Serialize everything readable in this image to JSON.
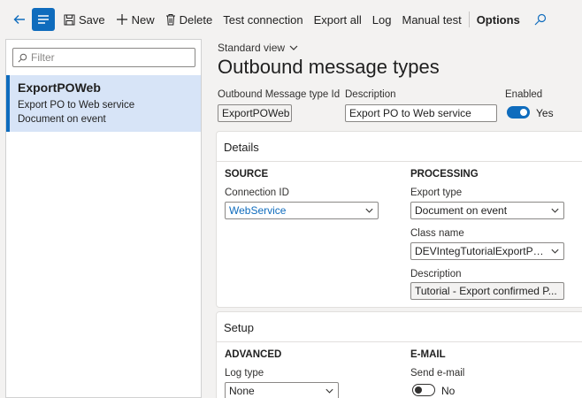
{
  "toolbar": {
    "save_label": "Save",
    "new_label": "New",
    "delete_label": "Delete",
    "test_connection_label": "Test connection",
    "export_all_label": "Export all",
    "log_label": "Log",
    "manual_test_label": "Manual test",
    "options_label": "Options"
  },
  "list": {
    "filter_placeholder": "Filter",
    "items": [
      {
        "title": "ExportPOWeb",
        "line1": "Export PO to Web service",
        "line2": "Document on event"
      }
    ]
  },
  "form": {
    "view_label": "Standard view",
    "title": "Outbound message types",
    "type_id_label": "Outbound Message type Id",
    "type_id_value": "ExportPOWeb",
    "description_label": "Description",
    "description_value": "Export PO to Web service",
    "enabled_label": "Enabled",
    "enabled_value": "Yes"
  },
  "details": {
    "title": "Details",
    "source_heading": "SOURCE",
    "connection_label": "Connection ID",
    "connection_value": "WebService",
    "processing_heading": "PROCESSING",
    "export_type_label": "Export type",
    "export_type_value": "Document on event",
    "class_name_label": "Class name",
    "class_name_value": "DEVIntegTutorialExportPur...",
    "description_label": "Description",
    "description_value": "Tutorial - Export confirmed P..."
  },
  "setup": {
    "title": "Setup",
    "advanced_heading": "ADVANCED",
    "log_type_label": "Log type",
    "log_type_value": "None",
    "email_heading": "E-MAIL",
    "send_email_label": "Send e-mail",
    "send_email_value": "No"
  },
  "colors": {
    "accent": "#0f6cbd",
    "selected_row": "#d7e4f7"
  }
}
